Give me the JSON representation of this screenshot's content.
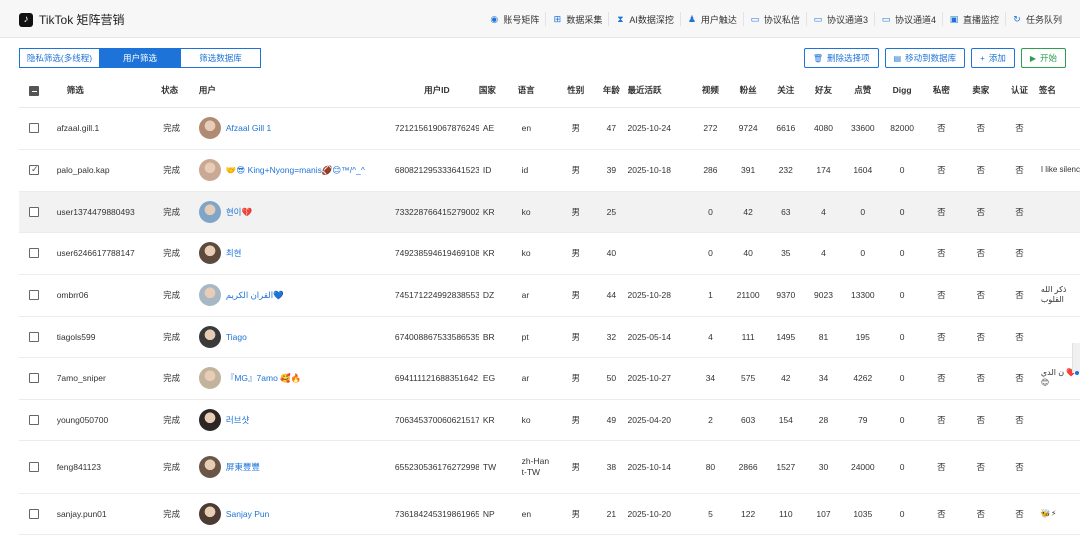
{
  "app": {
    "logo_icon": "tiktok-logo-icon",
    "title": "TikTok 矩阵营销"
  },
  "nav": [
    {
      "label": "账号矩阵",
      "icon": "account-matrix-icon",
      "glyph": "◉"
    },
    {
      "label": "数据采集",
      "icon": "grid-icon",
      "glyph": "⊞"
    },
    {
      "label": "AI数据深挖",
      "icon": "hourglass-icon",
      "glyph": "⧗"
    },
    {
      "label": "用户触达",
      "icon": "user-icon",
      "glyph": "♟"
    },
    {
      "label": "协议私信",
      "icon": "chat-icon",
      "glyph": "▭"
    },
    {
      "label": "协议通道3",
      "icon": "chat-icon",
      "glyph": "▭"
    },
    {
      "label": "协议通道4",
      "icon": "chat-icon",
      "glyph": "▭"
    },
    {
      "label": "直播监控",
      "icon": "live-icon",
      "glyph": "▣"
    },
    {
      "label": "任务队列",
      "icon": "refresh-icon",
      "glyph": "↻"
    }
  ],
  "tabs": [
    {
      "label": "隐私筛选(多线程)",
      "active": false
    },
    {
      "label": "用户筛选",
      "active": true
    },
    {
      "label": "筛选数据库",
      "active": false
    }
  ],
  "actions": [
    {
      "label": "删除选择项",
      "icon": "trash-icon",
      "glyph": "🗑",
      "style": "blue"
    },
    {
      "label": "移动到数据库",
      "icon": "save-icon",
      "glyph": "▤",
      "style": "blue"
    },
    {
      "label": "添加",
      "icon": "plus-icon",
      "glyph": "+",
      "style": "blue"
    },
    {
      "label": "开始",
      "icon": "play-icon",
      "glyph": "▶",
      "style": "green"
    }
  ],
  "columns": [
    "筛选",
    "状态",
    "用户",
    "用户ID",
    "国家",
    "语言",
    "性别",
    "年龄",
    "最近活跃",
    "视频",
    "粉丝",
    "关注",
    "好友",
    "点赞",
    "Digg",
    "私密",
    "卖家",
    "认证",
    "签名"
  ],
  "rows": [
    {
      "checked": false,
      "filter": "afzaal.gill.1",
      "status": "完成",
      "user": "Afzaal Gill 1",
      "user_id": "7212156190678762497",
      "country": "AE",
      "lang": "en",
      "gender": "男",
      "age": "47",
      "last_active": "2025-10-24",
      "videos": "272",
      "fans": "9724",
      "following": "6616",
      "friends": "4080",
      "likes": "33600",
      "digg": "82000",
      "private": "否",
      "seller": "否",
      "verified": "否",
      "signature": "",
      "avatar_color": "#b08a72",
      "highlight": false
    },
    {
      "checked": true,
      "filter": "palo_palo.kap",
      "status": "完成",
      "user": "🤝😎 King+Nyong=manis🏈😊™/^_^",
      "user_id": "6808212953336415233",
      "country": "ID",
      "lang": "id",
      "gender": "男",
      "age": "39",
      "last_active": "2025-10-18",
      "videos": "286",
      "fans": "391",
      "following": "232",
      "friends": "174",
      "likes": "1604",
      "digg": "0",
      "private": "否",
      "seller": "否",
      "verified": "否",
      "signature": "I like silenc",
      "avatar_color": "#c9a894",
      "highlight": false
    },
    {
      "checked": false,
      "filter": "user1374479880493",
      "status": "完成",
      "user": "현이💔",
      "user_id": "7332287664152790021",
      "country": "KR",
      "lang": "ko",
      "gender": "男",
      "age": "25",
      "last_active": "",
      "videos": "0",
      "fans": "42",
      "following": "63",
      "friends": "4",
      "likes": "0",
      "digg": "0",
      "private": "否",
      "seller": "否",
      "verified": "否",
      "signature": "",
      "avatar_color": "#7fa6c8",
      "highlight": true
    },
    {
      "checked": false,
      "filter": "user6246617788147",
      "status": "完成",
      "user": "최현",
      "user_id": "7492385946194691088",
      "country": "KR",
      "lang": "ko",
      "gender": "男",
      "age": "40",
      "last_active": "",
      "videos": "0",
      "fans": "40",
      "following": "35",
      "friends": "4",
      "likes": "0",
      "digg": "0",
      "private": "否",
      "seller": "否",
      "verified": "否",
      "signature": "",
      "avatar_color": "#5d4a3c",
      "highlight": false
    },
    {
      "checked": false,
      "filter": "ombrr06",
      "status": "完成",
      "user": "القران الكريم💙",
      "user_id": "7451712249928385538",
      "country": "DZ",
      "lang": "ar",
      "gender": "男",
      "age": "44",
      "last_active": "2025-10-28",
      "videos": "1",
      "fans": "21100",
      "following": "9370",
      "friends": "9023",
      "likes": "13300",
      "digg": "0",
      "private": "否",
      "seller": "否",
      "verified": "否",
      "signature": "ذكر الله القلوب",
      "avatar_color": "#a7b8c4",
      "highlight": false
    },
    {
      "checked": false,
      "filter": "tiagols599",
      "status": "完成",
      "user": "Tiago",
      "user_id": "6740088675335865350",
      "country": "BR",
      "lang": "pt",
      "gender": "男",
      "age": "32",
      "last_active": "2025-05-14",
      "videos": "4",
      "fans": "111",
      "following": "1495",
      "friends": "81",
      "likes": "195",
      "digg": "0",
      "private": "否",
      "seller": "否",
      "verified": "否",
      "signature": "",
      "avatar_color": "#3a3a3a",
      "highlight": false
    },
    {
      "checked": false,
      "filter": "7amo_sniper",
      "status": "完成",
      "user": "『MG』7amo 🥰🔥",
      "user_id": "6941111216883516421",
      "country": "EG",
      "lang": "ar",
      "gender": "男",
      "age": "50",
      "last_active": "2025-10-27",
      "videos": "34",
      "fans": "575",
      "following": "42",
      "friends": "34",
      "likes": "4262",
      "digg": "0",
      "private": "否",
      "seller": "否",
      "verified": "否",
      "signature": "ن الدي ❤️😊",
      "avatar_color": "#c2b39c",
      "highlight": false
    },
    {
      "checked": false,
      "filter": "young050700",
      "status": "完成",
      "user": "러브샷",
      "user_id": "7063453700606215170",
      "country": "KR",
      "lang": "ko",
      "gender": "男",
      "age": "49",
      "last_active": "2025-04-20",
      "videos": "2",
      "fans": "603",
      "following": "154",
      "friends": "28",
      "likes": "79",
      "digg": "0",
      "private": "否",
      "seller": "否",
      "verified": "否",
      "signature": "",
      "avatar_color": "#2c2624",
      "highlight": false
    },
    {
      "checked": false,
      "filter": "feng841123",
      "status": "完成",
      "user": "屏東豐豐",
      "user_id": "6552305361762729985",
      "country": "TW",
      "lang": "zh-Hant-TW",
      "gender": "男",
      "age": "38",
      "last_active": "2025-10-14",
      "videos": "80",
      "fans": "2866",
      "following": "1527",
      "friends": "30",
      "likes": "24000",
      "digg": "0",
      "private": "否",
      "seller": "否",
      "verified": "否",
      "signature": "",
      "avatar_color": "#6b5646",
      "highlight": false
    },
    {
      "checked": false,
      "filter": "sanjay.pun01",
      "status": "完成",
      "user": "Sanjay Pun",
      "user_id": "7361842453198619654",
      "country": "NP",
      "lang": "en",
      "gender": "男",
      "age": "21",
      "last_active": "2025-10-20",
      "videos": "5",
      "fans": "122",
      "following": "110",
      "friends": "107",
      "likes": "1035",
      "digg": "0",
      "private": "否",
      "seller": "否",
      "verified": "否",
      "signature": "🐝⚡",
      "avatar_color": "#4b3b33",
      "highlight": false
    }
  ]
}
